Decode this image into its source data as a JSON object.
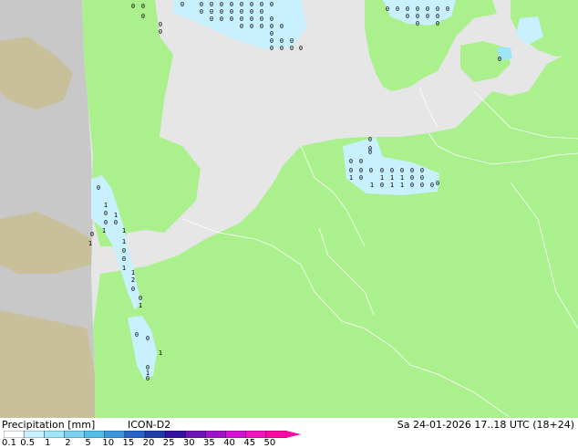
{
  "footer": {
    "title": "Precipitation [mm]",
    "model": "ICON-D2",
    "datetime": "Sa 24-01-2026 17..18 UTC (18+24)"
  },
  "legend": {
    "ticks": [
      "0.1",
      "0.5",
      "1",
      "2",
      "5",
      "10",
      "15",
      "20",
      "25",
      "30",
      "35",
      "40",
      "45",
      "50"
    ],
    "colors": [
      "#ffffff",
      "#c8f0ff",
      "#a0e6fa",
      "#78d2f0",
      "#50bee6",
      "#3c96dc",
      "#2864c8",
      "#1e3caa",
      "#3214a0",
      "#6e14b4",
      "#a014c8",
      "#d214d2",
      "#f014be",
      "#fa0aa0"
    ]
  },
  "map": {
    "colors": {
      "sea": "#e6e6e6",
      "land_model": "#aaf08c",
      "land_outside": "#c8c8c8",
      "land_outside_tan": "#c8c09a",
      "precip_light": "#c8f0ff",
      "precip_medium": "#a0e6fa",
      "border": "#ffffff"
    },
    "cell_values": [
      "0",
      "0",
      "0",
      "0",
      "0",
      "0",
      "0",
      "0",
      "0",
      "0",
      "0",
      "0",
      "0",
      "0",
      "0",
      "0",
      "0",
      "0",
      "0",
      "0",
      "0",
      "0",
      "0",
      "0",
      "0",
      "0",
      "0",
      "0",
      "0",
      "0",
      "0",
      "0",
      "0",
      "0",
      "0",
      "0",
      "0",
      "0",
      "0",
      "0",
      "0",
      "0",
      "0",
      "0",
      "0",
      "0",
      "0",
      "0",
      "0",
      "0",
      "0",
      "0",
      "0",
      "0",
      "0",
      "0",
      "0",
      "0",
      "0",
      "0",
      "0",
      "0",
      "0",
      "0",
      "0",
      "0",
      "0",
      "0",
      "0",
      "1",
      "0",
      "1",
      "1",
      "1",
      "0",
      "0",
      "1",
      "0",
      "1",
      "0",
      "0",
      "1",
      "1",
      "0",
      "1",
      "1",
      "0",
      "0",
      "1",
      "1",
      "2",
      "0",
      "0",
      "1",
      "0",
      "0",
      "1",
      "0",
      "1",
      "0",
      "0",
      "1",
      "0",
      "1",
      "1",
      "0",
      "0",
      "0",
      "0",
      "0",
      "0",
      "0",
      "0",
      "0",
      "0",
      "0"
    ]
  }
}
